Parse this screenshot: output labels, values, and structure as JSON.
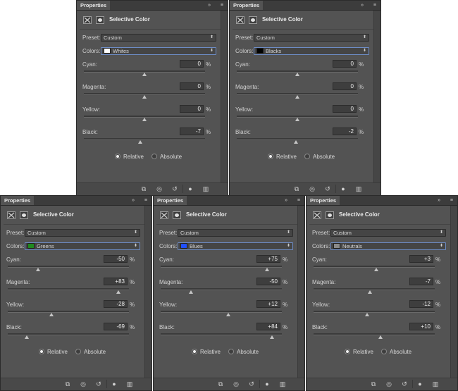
{
  "common": {
    "tab_label": "Properties",
    "collapse_glyph": "»",
    "menu_glyph": "≡",
    "panel_title": "Selective Color",
    "preset_label": "Preset:",
    "colors_label": "Colors:",
    "cyan_label": "Cyan:",
    "magenta_label": "Magenta:",
    "yellow_label": "Yellow:",
    "black_label": "Black:",
    "percent": "%",
    "relative_label": "Relative",
    "absolute_label": "Absolute",
    "dropdown_glyph": "⬍",
    "footer_icons": [
      "clip-to-layer-icon",
      "view-previous-state-icon",
      "reset-icon",
      "visibility-eye-icon",
      "trash-icon"
    ]
  },
  "panels": [
    {
      "preset": "Custom",
      "color_name": "Whites",
      "swatch": "#ffffff",
      "cyan": "0",
      "magenta": "0",
      "yellow": "0",
      "black": "-7",
      "cyan_pct": 0,
      "magenta_pct": 0,
      "yellow_pct": 0,
      "black_pct": -7,
      "method": "Relative"
    },
    {
      "preset": "Custom",
      "color_name": "Blacks",
      "swatch": "#000000",
      "cyan": "0",
      "magenta": "0",
      "yellow": "0",
      "black": "-2",
      "cyan_pct": 0,
      "magenta_pct": 0,
      "yellow_pct": 0,
      "black_pct": -2,
      "method": "Relative"
    },
    {
      "preset": "Custom",
      "color_name": "Greens",
      "swatch": "#1f8a1f",
      "cyan": "-50",
      "magenta": "+83",
      "yellow": "-28",
      "black": "-69",
      "cyan_pct": -50,
      "magenta_pct": 83,
      "yellow_pct": -28,
      "black_pct": -69,
      "method": "Relative"
    },
    {
      "preset": "Custom",
      "color_name": "Blues",
      "swatch": "#1f4fff",
      "cyan": "+75",
      "magenta": "-50",
      "yellow": "+12",
      "black": "+84",
      "cyan_pct": 75,
      "magenta_pct": -50,
      "yellow_pct": 12,
      "black_pct": 84,
      "method": "Relative"
    },
    {
      "preset": "Custom",
      "color_name": "Neutrals",
      "swatch": "#8a8a8a",
      "cyan": "+3",
      "magenta": "-7",
      "yellow": "-12",
      "black": "+10",
      "cyan_pct": 3,
      "magenta_pct": -7,
      "yellow_pct": -12,
      "black_pct": 10,
      "method": "Relative"
    }
  ]
}
